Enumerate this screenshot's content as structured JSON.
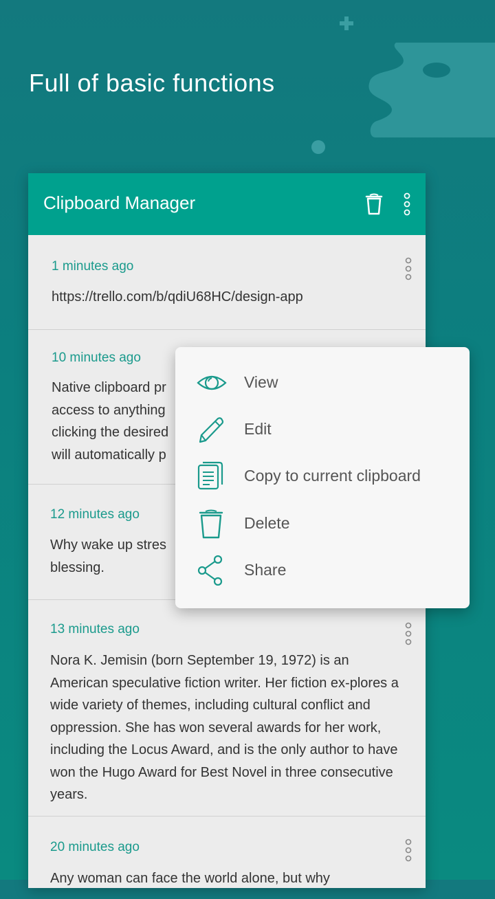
{
  "headline": "Full of basic functions",
  "colors": {
    "background": "#0c7f7f",
    "appbar": "#00a18e",
    "accent": "#1a9a8c",
    "card": "#ececec",
    "menu": "#f7f7f7"
  },
  "appbar": {
    "title": "Clipboard Manager",
    "icons": [
      "trash-icon",
      "more-vert-icon"
    ]
  },
  "clips": [
    {
      "time": "1 minutes ago",
      "text": "https://trello.com/b/qdiU68HC/design-app"
    },
    {
      "time": "10 minutes ago",
      "text": "Native clipboard pr access to anything clicking the desired will automatically p"
    },
    {
      "time": "12 minutes ago",
      "text": "Why wake up stres blessing."
    },
    {
      "time": "13 minutes ago",
      "text": "Nora K. Jemisin (born September 19, 1972) is an American speculative fiction writer. Her fiction ex-plores a wide variety of themes, including cultural conflict and oppression. She has won several awards for her work, including the Locus Award, and is the only author to have won the Hugo Award for Best Novel in three consecutive years."
    },
    {
      "time": "20 minutes ago",
      "text": "Any woman can face the world alone, but why"
    }
  ],
  "menu": {
    "items": [
      {
        "label": "View",
        "icon": "eye-icon"
      },
      {
        "label": "Edit",
        "icon": "pencil-icon"
      },
      {
        "label": "Copy to current clipboard",
        "icon": "copy-icon"
      },
      {
        "label": "Delete",
        "icon": "trash-icon"
      },
      {
        "label": "Share",
        "icon": "share-icon"
      }
    ]
  }
}
